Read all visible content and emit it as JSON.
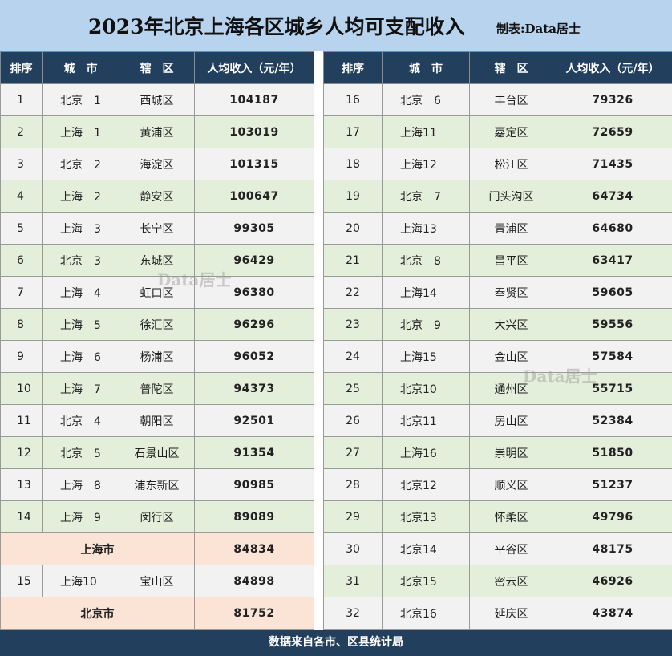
{
  "header": {
    "title": "2023年北京上海各区城乡人均可支配收入",
    "maker": "制表:Data居士"
  },
  "columns": [
    "排序",
    "城　市",
    "辖　区",
    "人均收入（元/年）"
  ],
  "left_rows": [
    {
      "type": "rank",
      "rank": "1",
      "city": "北京　1",
      "district": "西城区",
      "income": "104187"
    },
    {
      "type": "rank",
      "rank": "2",
      "city": "上海　1",
      "district": "黄浦区",
      "income": "103019"
    },
    {
      "type": "rank",
      "rank": "3",
      "city": "北京　2",
      "district": "海淀区",
      "income": "101315"
    },
    {
      "type": "rank",
      "rank": "4",
      "city": "上海　2",
      "district": "静安区",
      "income": "100647"
    },
    {
      "type": "rank",
      "rank": "5",
      "city": "上海　3",
      "district": "长宁区",
      "income": "99305"
    },
    {
      "type": "rank",
      "rank": "6",
      "city": "北京　3",
      "district": "东城区",
      "income": "96429"
    },
    {
      "type": "rank",
      "rank": "7",
      "city": "上海　4",
      "district": "虹口区",
      "income": "96380"
    },
    {
      "type": "rank",
      "rank": "8",
      "city": "上海　5",
      "district": "徐汇区",
      "income": "96296"
    },
    {
      "type": "rank",
      "rank": "9",
      "city": "上海　6",
      "district": "杨浦区",
      "income": "96052"
    },
    {
      "type": "rank",
      "rank": "10",
      "city": "上海　7",
      "district": "普陀区",
      "income": "94373"
    },
    {
      "type": "rank",
      "rank": "11",
      "city": "北京　4",
      "district": "朝阳区",
      "income": "92501"
    },
    {
      "type": "rank",
      "rank": "12",
      "city": "北京　5",
      "district": "石景山区",
      "income": "91354"
    },
    {
      "type": "rank",
      "rank": "13",
      "city": "上海　8",
      "district": "浦东新区",
      "income": "90985"
    },
    {
      "type": "rank",
      "rank": "14",
      "city": "上海　9",
      "district": "闵行区",
      "income": "89089"
    },
    {
      "type": "summary",
      "label": "上海市",
      "income": "84834"
    },
    {
      "type": "rank",
      "rank": "15",
      "city": "上海10",
      "district": "宝山区",
      "income": "84898"
    },
    {
      "type": "summary",
      "label": "北京市",
      "income": "81752"
    }
  ],
  "right_rows": [
    {
      "rank": "16",
      "city": "北京　6",
      "district": "丰台区",
      "income": "79326"
    },
    {
      "rank": "17",
      "city": "上海11",
      "district": "嘉定区",
      "income": "72659"
    },
    {
      "rank": "18",
      "city": "上海12",
      "district": "松江区",
      "income": "71435"
    },
    {
      "rank": "19",
      "city": "北京　7",
      "district": "门头沟区",
      "income": "64734"
    },
    {
      "rank": "20",
      "city": "上海13",
      "district": "青浦区",
      "income": "64680"
    },
    {
      "rank": "21",
      "city": "北京　8",
      "district": "昌平区",
      "income": "63417"
    },
    {
      "rank": "22",
      "city": "上海14",
      "district": "奉贤区",
      "income": "59605"
    },
    {
      "rank": "23",
      "city": "北京　9",
      "district": "大兴区",
      "income": "59556"
    },
    {
      "rank": "24",
      "city": "上海15",
      "district": "金山区",
      "income": "57584"
    },
    {
      "rank": "25",
      "city": "北京10",
      "district": "通州区",
      "income": "55715"
    },
    {
      "rank": "26",
      "city": "北京11",
      "district": "房山区",
      "income": "52384"
    },
    {
      "rank": "27",
      "city": "上海16",
      "district": "崇明区",
      "income": "51850"
    },
    {
      "rank": "28",
      "city": "北京12",
      "district": "顺义区",
      "income": "51237"
    },
    {
      "rank": "29",
      "city": "北京13",
      "district": "怀柔区",
      "income": "49796"
    },
    {
      "rank": "30",
      "city": "北京14",
      "district": "平谷区",
      "income": "48175"
    },
    {
      "rank": "31",
      "city": "北京15",
      "district": "密云区",
      "income": "46926"
    },
    {
      "rank": "32",
      "city": "北京16",
      "district": "延庆区",
      "income": "43874"
    }
  ],
  "footer": {
    "text": "数据来自各市、区县统计局"
  },
  "watermark": {
    "text": "Data居士"
  }
}
